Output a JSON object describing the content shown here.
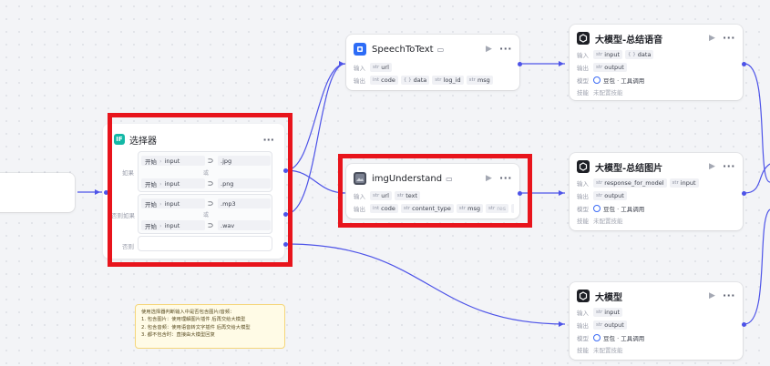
{
  "colors": {
    "wire": "#4d53e8",
    "highlight": "#e8141c",
    "note_bg": "#fffbe6"
  },
  "labels": {
    "input": "输入",
    "output": "输出",
    "model": "模型",
    "skills": "技能"
  },
  "nodes": {
    "speech": {
      "title": "SpeechToText",
      "icon": "speech-node-icon",
      "inputs": [
        {
          "type": "str",
          "name": "url"
        }
      ],
      "outputs": [
        {
          "type": "int",
          "name": "code"
        },
        {
          "type": "{ }",
          "name": "data"
        },
        {
          "type": "str",
          "name": "log_id"
        },
        {
          "type": "str",
          "name": "msg"
        }
      ]
    },
    "img": {
      "title": "imgUnderstand",
      "icon": "image-node-icon",
      "inputs": [
        {
          "type": "str",
          "name": "url"
        },
        {
          "type": "str",
          "name": "text"
        }
      ],
      "outputs": [
        {
          "type": "int",
          "name": "code"
        },
        {
          "type": "str",
          "name": "content_type"
        },
        {
          "type": "str",
          "name": "msg"
        },
        {
          "type": "str",
          "name": "res"
        }
      ],
      "more": "..."
    },
    "llm_voice": {
      "title": "大模型-总结语音",
      "inputs": [
        {
          "type": "str",
          "name": "input"
        },
        {
          "type": "{ }",
          "name": "data"
        }
      ],
      "outputs": [
        {
          "type": "str",
          "name": "output"
        }
      ],
      "model": "豆包 · 工具调用",
      "skills": "未配置技能"
    },
    "llm_image": {
      "title": "大模型-总结图片",
      "inputs": [
        {
          "type": "str",
          "name": "response_for_model"
        },
        {
          "type": "str",
          "name": "input"
        }
      ],
      "outputs": [
        {
          "type": "str",
          "name": "output"
        }
      ],
      "model": "豆包 · 工具调用",
      "skills": "未配置技能"
    },
    "llm": {
      "title": "大模型",
      "inputs": [
        {
          "type": "str",
          "name": "input"
        }
      ],
      "outputs": [
        {
          "type": "str",
          "name": "output"
        }
      ],
      "model": "豆包 · 工具调用",
      "skills": "未配置技能"
    }
  },
  "selector": {
    "title": "选择器",
    "badge": "IF",
    "if_label": "如果",
    "elif_label": "否则如果",
    "else_label": "否则",
    "or_label": "或",
    "conditions": [
      {
        "source": "开始",
        "var": "input",
        "op": "⊃",
        "value": ".jpg"
      },
      {
        "source": "开始",
        "var": "input",
        "op": "⊃",
        "value": ".png"
      },
      {
        "source": "开始",
        "var": "input",
        "op": "⊃",
        "value": ".mp3"
      },
      {
        "source": "开始",
        "var": "input",
        "op": "⊃",
        "value": ".wav"
      }
    ]
  },
  "note": {
    "lines": [
      "使用选择器判断输入中是否包含图片/音频：",
      "1. 包含图片：使用理解图片插件 后再交给大模型",
      "2. 包含音频：使用语音转文字插件 后再交给大模型",
      "3. 都不包含时：直接由大模型回复"
    ]
  }
}
